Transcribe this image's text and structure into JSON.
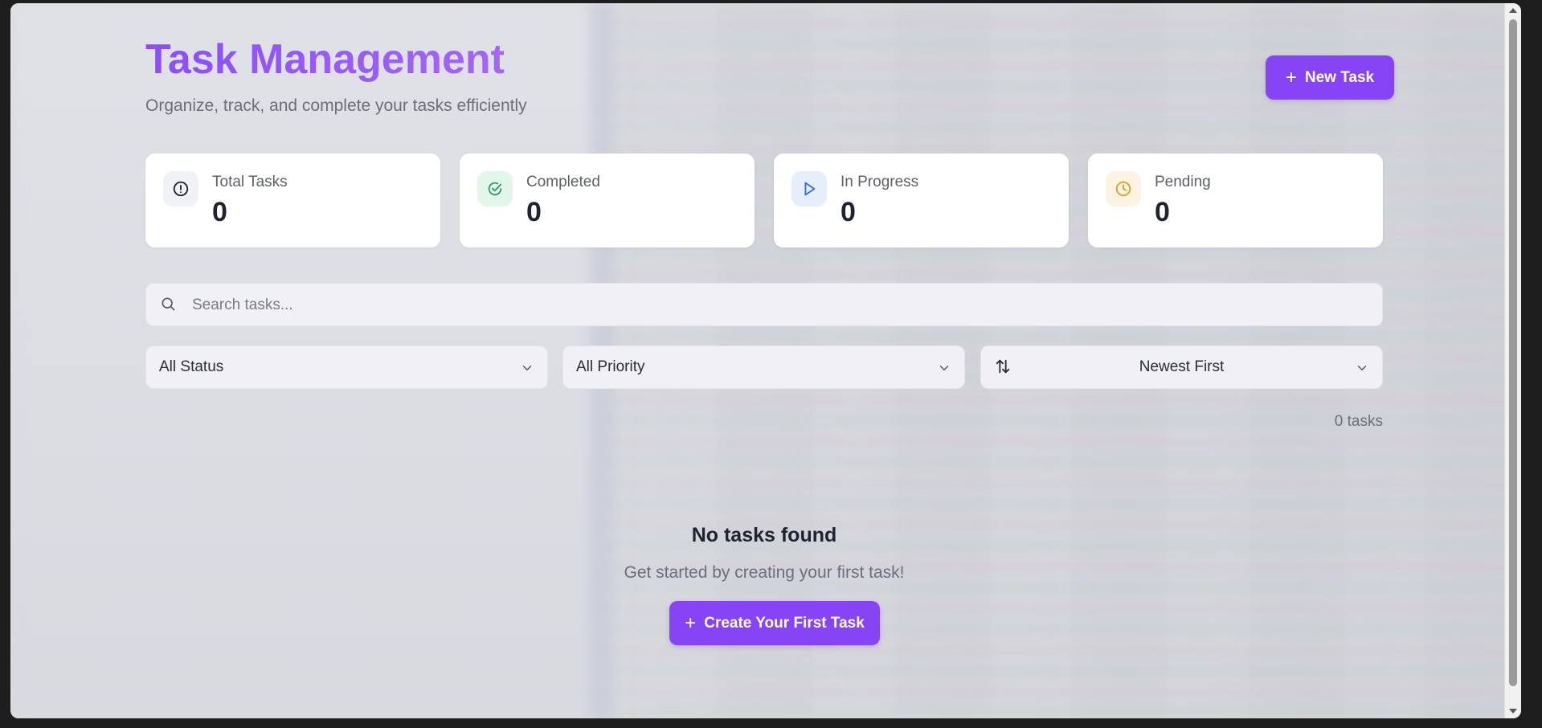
{
  "header": {
    "title": "Task Management",
    "subtitle": "Organize, track, and complete your tasks efficiently",
    "new_task_label": "New Task"
  },
  "stats": [
    {
      "label": "Total Tasks",
      "value": "0",
      "icon": "alert-circle-icon",
      "icon_color": "#1f2330",
      "icon_bg": "#f1f2f5"
    },
    {
      "label": "Completed",
      "value": "0",
      "icon": "check-circle-icon",
      "icon_color": "#22a559",
      "icon_bg": "#e3f6ea"
    },
    {
      "label": "In Progress",
      "value": "0",
      "icon": "play-icon",
      "icon_color": "#2f6be0",
      "icon_bg": "#e6edfb"
    },
    {
      "label": "Pending",
      "value": "0",
      "icon": "clock-icon",
      "icon_color": "#e0a023",
      "icon_bg": "#fcf3e2"
    }
  ],
  "search": {
    "placeholder": "Search tasks..."
  },
  "filters": {
    "status": "All Status",
    "priority": "All Priority",
    "sort": "Newest First"
  },
  "task_count": "0 tasks",
  "empty_state": {
    "title": "No tasks found",
    "subtitle": "Get started by creating your first task!",
    "button_label": "Create Your First Task"
  },
  "colors": {
    "accent": "#8644f5",
    "title_gradient_start": "#8b4dff",
    "title_gradient_end": "#a466f5"
  }
}
